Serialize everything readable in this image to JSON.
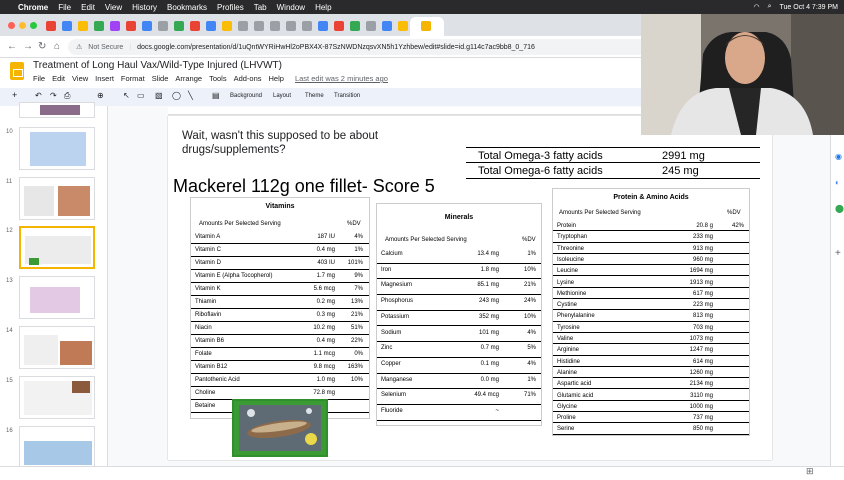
{
  "mac_menubar": {
    "items": [
      "Chrome",
      "File",
      "Edit",
      "View",
      "History",
      "Bookmarks",
      "Profiles",
      "Tab",
      "Window",
      "Help"
    ],
    "datetime": "Tue Oct 4 7:39 PM"
  },
  "address_bar": {
    "security": "Not Secure",
    "url": "docs.google.com/presentation/d/1uQntWYRiHwHl2oPBX4X-87SzNWDNzqsvXN5h1Yzhbew/edit#slide=id.g114c7ac9bb8_0_716"
  },
  "doc": {
    "title": "Treatment of Long Haul Vax/Wild-Type Injured (LHVWT)",
    "menu": [
      "File",
      "Edit",
      "View",
      "Insert",
      "Format",
      "Slide",
      "Arrange",
      "Tools",
      "Add-ons",
      "Help"
    ],
    "last_edit": "Last edit was 2 minutes ago"
  },
  "toolbar": {
    "background": "Background",
    "layout": "Layout",
    "theme": "Theme",
    "transition": "Transition"
  },
  "filmstrip": {
    "numbers": [
      "10",
      "11",
      "12",
      "13",
      "14",
      "15",
      "16"
    ],
    "selected": "12"
  },
  "slide": {
    "question": "Wait, wasn't this supposed to be about drugs/supplements?",
    "title": "Mackerel 112g one fillet- Score 5",
    "omega": [
      {
        "label": "Total Omega-3 fatty acids",
        "value": "2991 mg"
      },
      {
        "label": "Total Omega-6 fatty acids",
        "value": "245 mg"
      }
    ],
    "vitamins": {
      "heading": "Vitamins",
      "col_left": "Amounts Per Selected Serving",
      "col_right": "%DV",
      "rows": [
        {
          "name": "Vitamin A",
          "amount": "187 IU",
          "dv": "4%"
        },
        {
          "name": "Vitamin C",
          "amount": "0.4 mg",
          "dv": "1%"
        },
        {
          "name": "Vitamin D",
          "amount": "403 IU",
          "dv": "101%"
        },
        {
          "name": "Vitamin E (Alpha Tocopherol)",
          "amount": "1.7 mg",
          "dv": "9%"
        },
        {
          "name": "Vitamin K",
          "amount": "5.6 mcg",
          "dv": "7%"
        },
        {
          "name": "Thiamin",
          "amount": "0.2 mg",
          "dv": "13%"
        },
        {
          "name": "Riboflavin",
          "amount": "0.3 mg",
          "dv": "21%"
        },
        {
          "name": "Niacin",
          "amount": "10.2 mg",
          "dv": "51%"
        },
        {
          "name": "Vitamin B6",
          "amount": "0.4 mg",
          "dv": "22%"
        },
        {
          "name": "Folate",
          "amount": "1.1 mcg",
          "dv": "0%"
        },
        {
          "name": "Vitamin B12",
          "amount": "9.8 mcg",
          "dv": "163%"
        },
        {
          "name": "Pantothenic Acid",
          "amount": "1.0 mg",
          "dv": "10%"
        },
        {
          "name": "Choline",
          "amount": "72.8 mg",
          "dv": ""
        },
        {
          "name": "Betaine",
          "amount": "",
          "dv": ""
        }
      ]
    },
    "minerals": {
      "heading": "Minerals",
      "col_left": "Amounts Per Selected Serving",
      "col_right": "%DV",
      "rows": [
        {
          "name": "Calcium",
          "amount": "13.4 mg",
          "dv": "1%"
        },
        {
          "name": "Iron",
          "amount": "1.8 mg",
          "dv": "10%"
        },
        {
          "name": "Magnesium",
          "amount": "85.1 mg",
          "dv": "21%"
        },
        {
          "name": "Phosphorus",
          "amount": "243 mg",
          "dv": "24%"
        },
        {
          "name": "Potassium",
          "amount": "352 mg",
          "dv": "10%"
        },
        {
          "name": "Sodium",
          "amount": "101 mg",
          "dv": "4%"
        },
        {
          "name": "Zinc",
          "amount": "0.7 mg",
          "dv": "5%"
        },
        {
          "name": "Copper",
          "amount": "0.1 mg",
          "dv": "4%"
        },
        {
          "name": "Manganese",
          "amount": "0.0 mg",
          "dv": "1%"
        },
        {
          "name": "Selenium",
          "amount": "49.4 mcg",
          "dv": "71%"
        },
        {
          "name": "Fluoride",
          "amount": "~",
          "dv": ""
        }
      ]
    },
    "protein": {
      "heading": "Protein & Amino Acids",
      "col_left": "Amounts Per Selected Serving",
      "col_right": "%DV",
      "rows": [
        {
          "name": "Protein",
          "amount": "20.8 g",
          "dv": "42%"
        },
        {
          "name": "Tryptophan",
          "amount": "233 mg",
          "dv": ""
        },
        {
          "name": "Threonine",
          "amount": "913 mg",
          "dv": ""
        },
        {
          "name": "Isoleucine",
          "amount": "960 mg",
          "dv": ""
        },
        {
          "name": "Leucine",
          "amount": "1694 mg",
          "dv": ""
        },
        {
          "name": "Lysine",
          "amount": "1913 mg",
          "dv": ""
        },
        {
          "name": "Methionine",
          "amount": "617 mg",
          "dv": ""
        },
        {
          "name": "Cystine",
          "amount": "223 mg",
          "dv": ""
        },
        {
          "name": "Phenylalanine",
          "amount": "813 mg",
          "dv": ""
        },
        {
          "name": "Tyrosine",
          "amount": "703 mg",
          "dv": ""
        },
        {
          "name": "Valine",
          "amount": "1073 mg",
          "dv": ""
        },
        {
          "name": "Arginine",
          "amount": "1247 mg",
          "dv": ""
        },
        {
          "name": "Histidine",
          "amount": "614 mg",
          "dv": ""
        },
        {
          "name": "Alanine",
          "amount": "1260 mg",
          "dv": ""
        },
        {
          "name": "Aspartic acid",
          "amount": "2134 mg",
          "dv": ""
        },
        {
          "name": "Glutamic acid",
          "amount": "3110 mg",
          "dv": ""
        },
        {
          "name": "Glycine",
          "amount": "1000 mg",
          "dv": ""
        },
        {
          "name": "Proline",
          "amount": "737 mg",
          "dv": ""
        },
        {
          "name": "Serine",
          "amount": "850 mg",
          "dv": ""
        }
      ]
    }
  },
  "colors": {
    "slides_yellow": "#f4b400",
    "fish_frame": "#3a9a34",
    "toolbar_bg": "#edf2fa"
  }
}
